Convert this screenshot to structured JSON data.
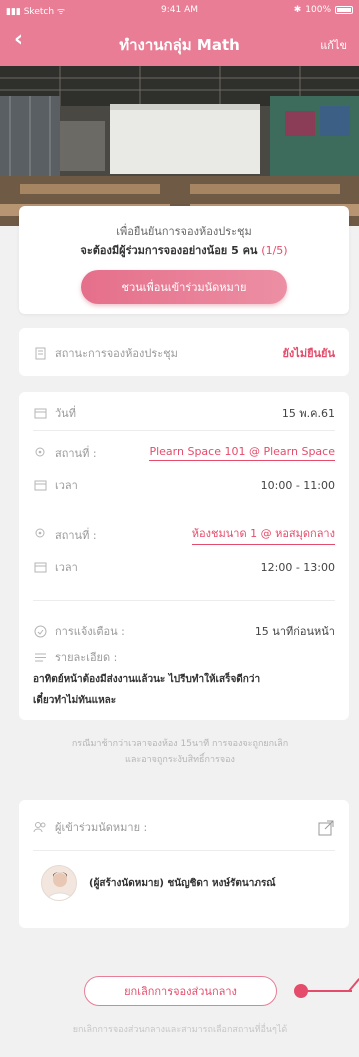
{
  "status_bar": {
    "carrier": "Sketch",
    "time": "9:41 AM",
    "battery": "100%"
  },
  "nav": {
    "back_icon": "chevron-left",
    "title": "ทำงานกลุ่ม Math",
    "edit_label": "แก้ไข"
  },
  "confirm_card": {
    "line1": "เพื่อยืนยันการจองห้องประชุม",
    "line2": "จะต้องมีผู้ร่วมการจองอย่างน้อย 5 คน",
    "count": "(1/5)",
    "invite_button": "ชวนเพื่อนเข้าร่วมนัดหมาย"
  },
  "status_card": {
    "label": "สถานะการจองห้องประชุม",
    "value": "ยังไม่ยืนยัน"
  },
  "detail_card": {
    "date_label": "วันที่",
    "date_value": "15 พ.ค.61",
    "slot1": {
      "place_label": "สถานที่ :",
      "place_value": "Plearn Space 101 @ Plearn Space",
      "time_label": "เวลา",
      "time_value": "10:00 - 11:00"
    },
    "slot2": {
      "place_label": "สถานที่ :",
      "place_value": "ห้องชมนาด 1 @ หอสมุดกลาง",
      "time_label": "เวลา",
      "time_value": "12:00 - 13:00"
    },
    "notify_label": "การแจ้งเตือน :",
    "notify_value": "15 นาทีก่อนหน้า",
    "detail_label": "รายละเอียด :",
    "detail_text_1": "อาทิตย์หน้าต้องมีส่งงานแล้วนะ ไปรีบทำให้เสร็จดีกว่า",
    "detail_text_2": "เดี๋ยวทำไม่ทันแหละ"
  },
  "notice": {
    "line1": "กรณีมาช้ากว่าเวลาจองห้อง 15นาที การจองจะถูกยกเลิก",
    "line2": "และอาจถูกระงับสิทธิ์การจอง"
  },
  "participants_card": {
    "label": "ผู้เข้าร่วมนัดหมาย :",
    "share_icon": "share-icon",
    "person": "(ผู้สร้างนัดหมาย) ชนัญชิดา หงษ์รัตนาภรณ์"
  },
  "bottom": {
    "cancel_button": "ยกเลิกการจองส่วนกลาง",
    "footer_text": "ยกเลิกการจองส่วนกลางและสามารถเลือกสถานที่อื่นๆได้"
  },
  "colors": {
    "accent": "#e97d95",
    "accent_dark": "#e54c6b"
  }
}
